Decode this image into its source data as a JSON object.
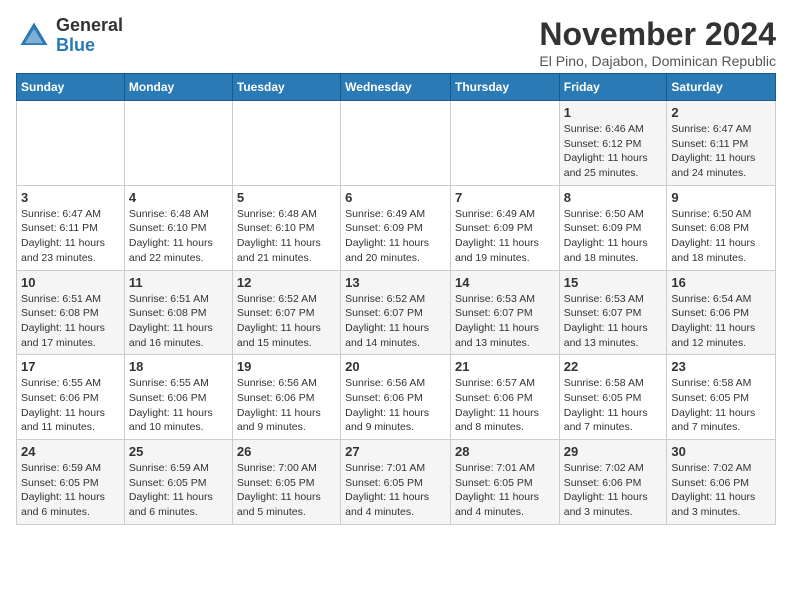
{
  "logo": {
    "general": "General",
    "blue": "Blue"
  },
  "header": {
    "month": "November 2024",
    "location": "El Pino, Dajabon, Dominican Republic"
  },
  "weekdays": [
    "Sunday",
    "Monday",
    "Tuesday",
    "Wednesday",
    "Thursday",
    "Friday",
    "Saturday"
  ],
  "weeks": [
    [
      {
        "day": "",
        "info": ""
      },
      {
        "day": "",
        "info": ""
      },
      {
        "day": "",
        "info": ""
      },
      {
        "day": "",
        "info": ""
      },
      {
        "day": "",
        "info": ""
      },
      {
        "day": "1",
        "info": "Sunrise: 6:46 AM\nSunset: 6:12 PM\nDaylight: 11 hours and 25 minutes."
      },
      {
        "day": "2",
        "info": "Sunrise: 6:47 AM\nSunset: 6:11 PM\nDaylight: 11 hours and 24 minutes."
      }
    ],
    [
      {
        "day": "3",
        "info": "Sunrise: 6:47 AM\nSunset: 6:11 PM\nDaylight: 11 hours and 23 minutes."
      },
      {
        "day": "4",
        "info": "Sunrise: 6:48 AM\nSunset: 6:10 PM\nDaylight: 11 hours and 22 minutes."
      },
      {
        "day": "5",
        "info": "Sunrise: 6:48 AM\nSunset: 6:10 PM\nDaylight: 11 hours and 21 minutes."
      },
      {
        "day": "6",
        "info": "Sunrise: 6:49 AM\nSunset: 6:09 PM\nDaylight: 11 hours and 20 minutes."
      },
      {
        "day": "7",
        "info": "Sunrise: 6:49 AM\nSunset: 6:09 PM\nDaylight: 11 hours and 19 minutes."
      },
      {
        "day": "8",
        "info": "Sunrise: 6:50 AM\nSunset: 6:09 PM\nDaylight: 11 hours and 18 minutes."
      },
      {
        "day": "9",
        "info": "Sunrise: 6:50 AM\nSunset: 6:08 PM\nDaylight: 11 hours and 18 minutes."
      }
    ],
    [
      {
        "day": "10",
        "info": "Sunrise: 6:51 AM\nSunset: 6:08 PM\nDaylight: 11 hours and 17 minutes."
      },
      {
        "day": "11",
        "info": "Sunrise: 6:51 AM\nSunset: 6:08 PM\nDaylight: 11 hours and 16 minutes."
      },
      {
        "day": "12",
        "info": "Sunrise: 6:52 AM\nSunset: 6:07 PM\nDaylight: 11 hours and 15 minutes."
      },
      {
        "day": "13",
        "info": "Sunrise: 6:52 AM\nSunset: 6:07 PM\nDaylight: 11 hours and 14 minutes."
      },
      {
        "day": "14",
        "info": "Sunrise: 6:53 AM\nSunset: 6:07 PM\nDaylight: 11 hours and 13 minutes."
      },
      {
        "day": "15",
        "info": "Sunrise: 6:53 AM\nSunset: 6:07 PM\nDaylight: 11 hours and 13 minutes."
      },
      {
        "day": "16",
        "info": "Sunrise: 6:54 AM\nSunset: 6:06 PM\nDaylight: 11 hours and 12 minutes."
      }
    ],
    [
      {
        "day": "17",
        "info": "Sunrise: 6:55 AM\nSunset: 6:06 PM\nDaylight: 11 hours and 11 minutes."
      },
      {
        "day": "18",
        "info": "Sunrise: 6:55 AM\nSunset: 6:06 PM\nDaylight: 11 hours and 10 minutes."
      },
      {
        "day": "19",
        "info": "Sunrise: 6:56 AM\nSunset: 6:06 PM\nDaylight: 11 hours and 9 minutes."
      },
      {
        "day": "20",
        "info": "Sunrise: 6:56 AM\nSunset: 6:06 PM\nDaylight: 11 hours and 9 minutes."
      },
      {
        "day": "21",
        "info": "Sunrise: 6:57 AM\nSunset: 6:06 PM\nDaylight: 11 hours and 8 minutes."
      },
      {
        "day": "22",
        "info": "Sunrise: 6:58 AM\nSunset: 6:05 PM\nDaylight: 11 hours and 7 minutes."
      },
      {
        "day": "23",
        "info": "Sunrise: 6:58 AM\nSunset: 6:05 PM\nDaylight: 11 hours and 7 minutes."
      }
    ],
    [
      {
        "day": "24",
        "info": "Sunrise: 6:59 AM\nSunset: 6:05 PM\nDaylight: 11 hours and 6 minutes."
      },
      {
        "day": "25",
        "info": "Sunrise: 6:59 AM\nSunset: 6:05 PM\nDaylight: 11 hours and 6 minutes."
      },
      {
        "day": "26",
        "info": "Sunrise: 7:00 AM\nSunset: 6:05 PM\nDaylight: 11 hours and 5 minutes."
      },
      {
        "day": "27",
        "info": "Sunrise: 7:01 AM\nSunset: 6:05 PM\nDaylight: 11 hours and 4 minutes."
      },
      {
        "day": "28",
        "info": "Sunrise: 7:01 AM\nSunset: 6:05 PM\nDaylight: 11 hours and 4 minutes."
      },
      {
        "day": "29",
        "info": "Sunrise: 7:02 AM\nSunset: 6:06 PM\nDaylight: 11 hours and 3 minutes."
      },
      {
        "day": "30",
        "info": "Sunrise: 7:02 AM\nSunset: 6:06 PM\nDaylight: 11 hours and 3 minutes."
      }
    ]
  ]
}
